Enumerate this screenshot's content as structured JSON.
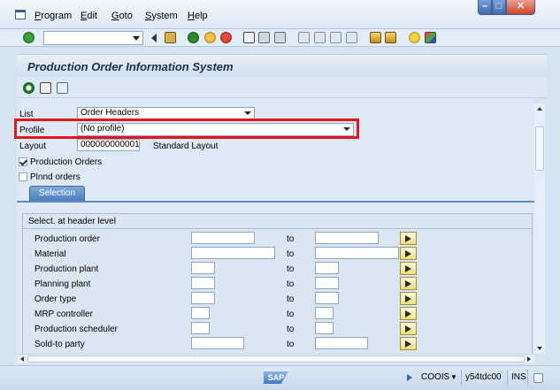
{
  "menu": {
    "items": [
      {
        "label": "Program",
        "accel": "P"
      },
      {
        "label": "Edit",
        "accel": "E"
      },
      {
        "label": "Goto",
        "accel": "G"
      },
      {
        "label": "System",
        "accel": "S"
      },
      {
        "label": "Help",
        "accel": "H"
      }
    ]
  },
  "toolbar": {
    "command_field_value": ""
  },
  "page": {
    "title": "Production Order Information System"
  },
  "header_fields": {
    "list_label": "List",
    "list_value": "Order Headers",
    "profile_label": "Profile",
    "profile_value": "(No profile)",
    "layout_label": "Layout",
    "layout_value": "000000000001",
    "layout_text": "Standard Layout",
    "production_orders_label": "Production Orders",
    "production_orders_checked": true,
    "planned_orders_label": "Plnnd orders",
    "planned_orders_checked": false
  },
  "tabs": {
    "selection": "Selection"
  },
  "selection_group": {
    "title": "Select. at header level",
    "to_label": "to",
    "rows": [
      {
        "label": "Production order"
      },
      {
        "label": "Material"
      },
      {
        "label": "Production plant"
      },
      {
        "label": "Planning plant"
      },
      {
        "label": "Order type"
      },
      {
        "label": "MRP controller"
      },
      {
        "label": "Production scheduler"
      },
      {
        "label": "Sold-to party"
      }
    ]
  },
  "statusbar": {
    "logo": "SAP",
    "transaction": "COOIS",
    "server": "y54tdc00",
    "mode": "INS"
  },
  "colors": {
    "highlight": "#e0181e",
    "tab_active": "#4d7fbd",
    "background": "#dfe9f5"
  }
}
